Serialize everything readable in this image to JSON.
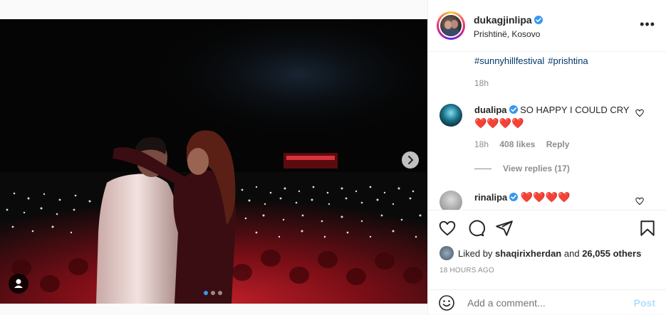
{
  "post": {
    "username": "dukagjinlipa",
    "location": "Prishtinë, Kosovo",
    "hashtags": [
      "#sunnyhillfestival",
      "#prishtina"
    ],
    "caption_time": "18h"
  },
  "comments": [
    {
      "username": "dualipa",
      "text": "SO HAPPY I COULD CRY",
      "hearts": "❤️❤️❤️❤️",
      "time": "18h",
      "likes": "408 likes",
      "reply_label": "Reply",
      "view_replies": "View replies (17)"
    },
    {
      "username": "rinalipa",
      "hearts": "❤️❤️❤️❤️"
    }
  ],
  "liked_by": {
    "prefix": "Liked by",
    "user": "shaqirixherdan",
    "joiner": "and",
    "others": "26,055 others"
  },
  "timestamp": "18 HOURS AGO",
  "add_comment": {
    "placeholder": "Add a comment...",
    "post_label": "Post"
  },
  "carousel": {
    "total": 3,
    "active": 1
  },
  "icons": [
    "verified-badge-icon",
    "more-options-icon",
    "heart-icon",
    "comment-icon",
    "share-icon",
    "bookmark-icon",
    "emoji-icon",
    "chevron-right-icon",
    "tag-user-icon"
  ],
  "colors": {
    "link": "#00376b",
    "verified": "#3897f0",
    "post_disabled": "#b2dffc",
    "heart_red": "#ed1c24"
  }
}
